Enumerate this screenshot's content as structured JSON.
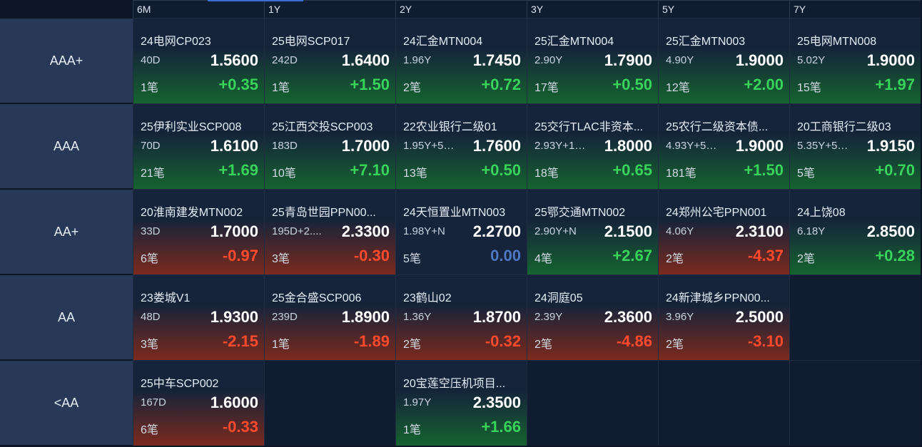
{
  "columns": [
    "6M",
    "1Y",
    "2Y",
    "3Y",
    "5Y",
    "7Y"
  ],
  "rows": [
    {
      "label": "AAA+",
      "cells": [
        {
          "name": "24电网CP023",
          "tenor": "40D",
          "yield": "1.5600",
          "count": "1笔",
          "change": "+0.35",
          "dir": "up"
        },
        {
          "name": "25电网SCP017",
          "tenor": "242D",
          "yield": "1.6400",
          "count": "1笔",
          "change": "+1.50",
          "dir": "up"
        },
        {
          "name": "24汇金MTN004",
          "tenor": "1.96Y",
          "yield": "1.7450",
          "count": "2笔",
          "change": "+0.72",
          "dir": "up"
        },
        {
          "name": "25汇金MTN004",
          "tenor": "2.90Y",
          "yield": "1.7900",
          "count": "17笔",
          "change": "+0.50",
          "dir": "up"
        },
        {
          "name": "25汇金MTN003",
          "tenor": "4.90Y",
          "yield": "1.9000",
          "count": "12笔",
          "change": "+2.00",
          "dir": "up"
        },
        {
          "name": "25电网MTN008",
          "tenor": "5.02Y",
          "yield": "1.9000",
          "count": "15笔",
          "change": "+1.97",
          "dir": "up"
        }
      ]
    },
    {
      "label": "AAA",
      "cells": [
        {
          "name": "25伊利实业SCP008",
          "tenor": "70D",
          "yield": "1.6100",
          "count": "21笔",
          "change": "+1.69",
          "dir": "up"
        },
        {
          "name": "25江西交投SCP003",
          "tenor": "183D",
          "yield": "1.7000",
          "count": "10笔",
          "change": "+7.10",
          "dir": "up"
        },
        {
          "name": "22农业银行二级01",
          "tenor": "1.95Y+5....",
          "yield": "1.7600",
          "count": "13笔",
          "change": "+0.50",
          "dir": "up"
        },
        {
          "name": "25交行TLAC非资本...",
          "tenor": "2.93Y+1....",
          "yield": "1.8000",
          "count": "18笔",
          "change": "+0.65",
          "dir": "up"
        },
        {
          "name": "25农行二级资本债...",
          "tenor": "4.93Y+5....",
          "yield": "1.9000",
          "count": "181笔",
          "change": "+1.50",
          "dir": "up"
        },
        {
          "name": "20工商银行二级03",
          "tenor": "5.35Y+5....",
          "yield": "1.9150",
          "count": "5笔",
          "change": "+0.70",
          "dir": "up"
        }
      ]
    },
    {
      "label": "AA+",
      "cells": [
        {
          "name": "20淮南建发MTN002",
          "tenor": "33D",
          "yield": "1.7000",
          "count": "6笔",
          "change": "-0.97",
          "dir": "down"
        },
        {
          "name": "25青岛世园PPN00...",
          "tenor": "195D+2....",
          "yield": "2.3300",
          "count": "3笔",
          "change": "-0.30",
          "dir": "down"
        },
        {
          "name": "24天恒置业MTN003",
          "tenor": "1.98Y+N",
          "yield": "2.2700",
          "count": "5笔",
          "change": "0.00",
          "dir": "flat"
        },
        {
          "name": "25鄂交通MTN002",
          "tenor": "2.90Y+N",
          "yield": "2.1500",
          "count": "4笔",
          "change": "+2.67",
          "dir": "up"
        },
        {
          "name": "24郑州公宅PPN001",
          "tenor": "4.06Y",
          "yield": "2.3100",
          "count": "2笔",
          "change": "-4.37",
          "dir": "down"
        },
        {
          "name": "24上饶08",
          "tenor": "6.18Y",
          "yield": "2.8500",
          "count": "2笔",
          "change": "+0.28",
          "dir": "up"
        }
      ]
    },
    {
      "label": "AA",
      "cells": [
        {
          "name": "23娄城V1",
          "tenor": "48D",
          "yield": "1.9300",
          "count": "3笔",
          "change": "-2.15",
          "dir": "down"
        },
        {
          "name": "25金合盛SCP006",
          "tenor": "239D",
          "yield": "1.8900",
          "count": "1笔",
          "change": "-1.89",
          "dir": "down"
        },
        {
          "name": "23鹤山02",
          "tenor": "1.36Y",
          "yield": "1.8700",
          "count": "2笔",
          "change": "-0.32",
          "dir": "down"
        },
        {
          "name": "24洞庭05",
          "tenor": "2.39Y",
          "yield": "2.3600",
          "count": "2笔",
          "change": "-4.86",
          "dir": "down"
        },
        {
          "name": "24新津城乡PPN00...",
          "tenor": "3.96Y",
          "yield": "2.5000",
          "count": "2笔",
          "change": "-3.10",
          "dir": "down"
        },
        null
      ]
    },
    {
      "label": "<AA",
      "cells": [
        {
          "name": "25中车SCP002",
          "tenor": "167D",
          "yield": "1.6000",
          "count": "6笔",
          "change": "-0.33",
          "dir": "down"
        },
        null,
        {
          "name": "20宝莲空压机项目...",
          "tenor": "1.97Y",
          "yield": "2.3500",
          "count": "1笔",
          "change": "+1.66",
          "dir": "up"
        },
        null,
        null,
        null
      ]
    }
  ]
}
